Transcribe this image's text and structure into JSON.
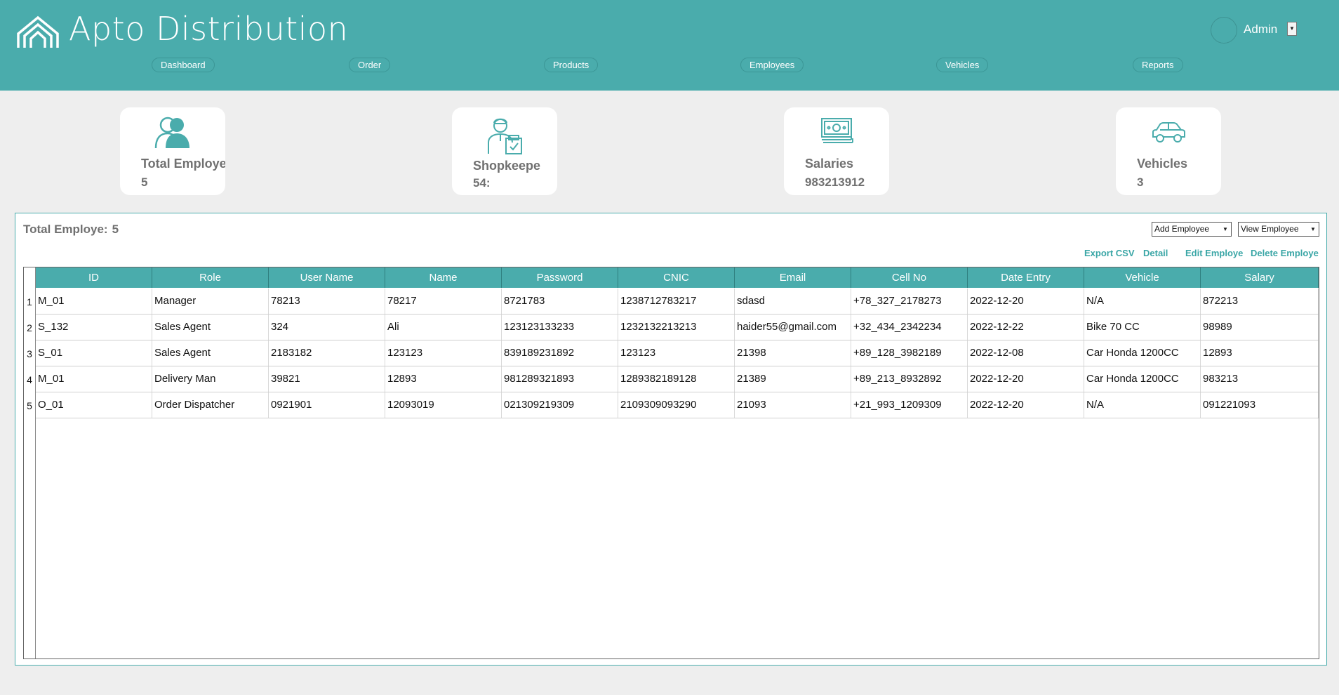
{
  "app": {
    "title": "Apto Distribution",
    "brand_color": "#4aacac",
    "logo_icon": "house-roof-logo-icon"
  },
  "user": {
    "name": "Admin",
    "avatar_icon": "avatar-icon",
    "dropdown_icon": "chevron-down-icon"
  },
  "nav": [
    {
      "label": "Dashboard"
    },
    {
      "label": "Order"
    },
    {
      "label": "Products"
    },
    {
      "label": "Employees"
    },
    {
      "label": "Vehicles"
    },
    {
      "label": "Reports"
    }
  ],
  "cards": [
    {
      "label": "Total Employe",
      "value": "5",
      "icon": "users-icon"
    },
    {
      "label": "Shopkeepe",
      "value": "54:",
      "icon": "shopkeeper-icon"
    },
    {
      "label": "Salaries",
      "value": "983213912",
      "icon": "money-icon"
    },
    {
      "label": "Vehicles",
      "value": "3",
      "icon": "car-icon"
    }
  ],
  "panel": {
    "title": "Total Employe:",
    "count": "5",
    "add_select": "Add Employee",
    "view_select": "View Employee",
    "actions": [
      "Export CSV",
      "Detail",
      "Edit Employe",
      "Delete Employe"
    ]
  },
  "table": {
    "columns": [
      "ID",
      "Role",
      "User Name",
      "Name",
      "Password",
      "CNIC",
      "Email",
      "Cell No",
      "Date Entry",
      "Vehicle",
      "Salary"
    ],
    "rows": [
      {
        "num": "1",
        "cells": [
          "M_01",
          "Manager",
          "78213",
          "78217",
          "8721783",
          "1238712783217",
          "sdasd",
          "+78_327_2178273",
          "2022-12-20",
          "N/A",
          "872213"
        ]
      },
      {
        "num": "2",
        "cells": [
          "S_132",
          "Sales Agent",
          "324",
          "Ali",
          "123123133233",
          "1232132213213",
          "haider55@gmail.com",
          "+32_434_2342234",
          "2022-12-22",
          "Bike 70 CC",
          "98989"
        ]
      },
      {
        "num": "3",
        "cells": [
          "S_01",
          "Sales Agent",
          "2183182",
          "123123",
          "839189231892",
          "123123",
          "21398",
          "+89_128_3982189",
          "2022-12-08",
          "Car Honda 1200CC",
          "12893"
        ]
      },
      {
        "num": "4",
        "cells": [
          "M_01",
          "Delivery Man",
          "39821",
          "12893",
          "981289321893",
          "1289382189128",
          "21389",
          "+89_213_8932892",
          "2022-12-20",
          "Car Honda 1200CC",
          "983213"
        ]
      },
      {
        "num": "5",
        "cells": [
          "O_01",
          "Order Dispatcher",
          "0921901",
          "12093019",
          "021309219309",
          "2109309093290",
          "21093",
          "+21_993_1209309",
          "2022-12-20",
          "N/A",
          "091221093"
        ]
      }
    ]
  }
}
